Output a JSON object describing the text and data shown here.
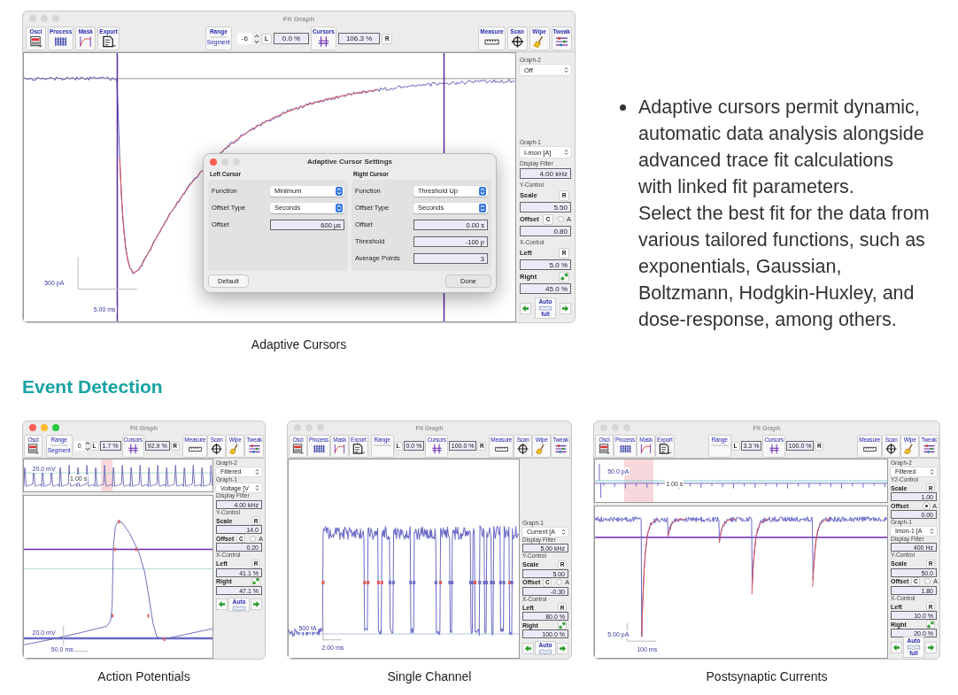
{
  "main_figure": {
    "window": {
      "title": "Fit Graph",
      "lights": [
        {
          "color": "#d6d6d6"
        },
        {
          "color": "#d6d6d6"
        },
        {
          "color": "#d6d6d6"
        }
      ],
      "tools_left": [
        {
          "label": "Osci",
          "kind": "osci"
        },
        {
          "label": "Process",
          "kind": "process"
        },
        {
          "label": "Mask",
          "kind": "mask"
        },
        {
          "label": "Export",
          "kind": "export"
        }
      ],
      "range": {
        "label": "Range",
        "sub": "Segment"
      },
      "stepper": "-6",
      "left_label": "L",
      "left_value": "0.0 %",
      "cursors": "Cursors",
      "right_value": "106.3 %",
      "right_label": "R",
      "tools_right": [
        {
          "label": "Measure",
          "kind": "measure"
        },
        {
          "label": "Scan",
          "kind": "scan"
        },
        {
          "label": "Wipe",
          "kind": "wipe"
        },
        {
          "label": "Tweak",
          "kind": "tweak"
        }
      ],
      "graph": {
        "kind": "decay",
        "y_scale": "500 pA",
        "x_scale": "5.00 ms"
      },
      "panel": [
        {
          "kind": "heading",
          "text": "Graph-2"
        },
        {
          "kind": "select",
          "value": "Off"
        },
        {
          "kind": "spacer"
        },
        {
          "kind": "heading",
          "text": "Graph-1"
        },
        {
          "kind": "select",
          "value": "I-mon [A]"
        },
        {
          "kind": "heading",
          "text": "Display Filter"
        },
        {
          "kind": "field",
          "value": "4.00 kHz"
        },
        {
          "kind": "heading",
          "text": "Y-Control"
        },
        {
          "kind": "label-button",
          "label": "Scale",
          "button": "R"
        },
        {
          "kind": "field",
          "value": "5.50"
        },
        {
          "kind": "offset",
          "label": "Offset",
          "button": "C",
          "radio_checked": false,
          "radio_label": "A"
        },
        {
          "kind": "field",
          "value": "0.80"
        },
        {
          "kind": "heading",
          "text": "X-Control"
        },
        {
          "kind": "label-button",
          "label": "Left",
          "button": "R"
        },
        {
          "kind": "field",
          "value": "5.0 %"
        },
        {
          "kind": "label-link",
          "label": "Right"
        },
        {
          "kind": "field",
          "value": "45.0 %"
        },
        {
          "kind": "nav",
          "label": "Auto",
          "sub": "full"
        }
      ]
    },
    "dialog": {
      "title": "Adaptive Cursor Settings",
      "lights": [
        {
          "color": "#fe5f57"
        },
        {
          "color": "#d6d6d6"
        },
        {
          "color": "#d6d6d6"
        }
      ],
      "groups": [
        {
          "title": "Left Cursor",
          "rows": [
            {
              "label": "Function",
              "kind": "select",
              "value": "Minimum"
            },
            {
              "label": "Offset Type",
              "kind": "select",
              "value": "Seconds"
            },
            {
              "label": "Offset",
              "kind": "field",
              "value": "600 µs"
            }
          ]
        },
        {
          "title": "Right Cursor",
          "rows": [
            {
              "label": "Function",
              "kind": "select",
              "value": "Threshold Up"
            },
            {
              "label": "Offset Type",
              "kind": "select",
              "value": "Seconds"
            },
            {
              "label": "Offset",
              "kind": "field",
              "value": "0.00 s"
            },
            {
              "label": "Threshold",
              "kind": "field",
              "value": "-100 p"
            },
            {
              "label": "Average Points",
              "kind": "field",
              "value": "3"
            }
          ]
        }
      ],
      "buttons": [
        "Default",
        "Done"
      ]
    },
    "caption": "Adaptive Cursors"
  },
  "description": {
    "paragraphs": [
      "Adaptive cursors permit dynamic, automatic data analysis alongside advanced trace fit calculations with linked fit parameters.",
      "Select the best fit for the data from various tailored functions, such as exponentials, Gaussian, Boltzmann, Hodgkin-Huxley, and dose-response, among others."
    ]
  },
  "section_heading": "Event Detection",
  "figures": [
    {
      "window": {
        "title": "Fit Graph",
        "lights": [
          {
            "color": "#fe5f57"
          },
          {
            "color": "#febc2e"
          },
          {
            "color": "#28c840"
          }
        ],
        "tools_left": [
          {
            "label": "Osci",
            "kind": "osci"
          }
        ],
        "range": {
          "label": "Range",
          "sub": "Segment"
        },
        "stepper": "0",
        "left_label": "L",
        "left_value": "1.7 %",
        "cursors": "Cursors",
        "right_value": "92.9 %",
        "right_label": "R",
        "tools_right": [
          {
            "label": "Measure",
            "kind": "measure"
          },
          {
            "label": "Scan",
            "kind": "scan"
          },
          {
            "label": "Wipe",
            "kind": "wipe"
          },
          {
            "label": "Tweak",
            "kind": "tweak"
          }
        ],
        "overview": {
          "kind": "spikes",
          "y_scale": "20.0 mV",
          "x_scale": "1.00 s"
        },
        "graph": {
          "kind": "action",
          "y_scale": "20.0 mV",
          "x_scale": "50.0 ms"
        },
        "panel": [
          {
            "kind": "heading",
            "text": "Graph-2"
          },
          {
            "kind": "select",
            "value": "Filtered"
          },
          {
            "kind": "heading",
            "text": "Graph-1"
          },
          {
            "kind": "select",
            "value": "Voltage [V"
          },
          {
            "kind": "heading",
            "text": "Display Filter"
          },
          {
            "kind": "field",
            "value": "4.00 kHz"
          },
          {
            "kind": "heading",
            "text": "Y-Control"
          },
          {
            "kind": "label-button",
            "label": "Scale",
            "button": "R"
          },
          {
            "kind": "field",
            "value": "14.0"
          },
          {
            "kind": "offset",
            "label": "Offset",
            "button": "C",
            "radio_checked": false,
            "radio_label": "A"
          },
          {
            "kind": "field",
            "value": "0.20"
          },
          {
            "kind": "heading",
            "text": "X-Control"
          },
          {
            "kind": "label-button",
            "label": "Left",
            "button": "R"
          },
          {
            "kind": "field",
            "value": "41.1 %"
          },
          {
            "kind": "label-link",
            "label": "Right"
          },
          {
            "kind": "field",
            "value": "47.1 %"
          },
          {
            "kind": "nav",
            "label": "Auto"
          }
        ]
      },
      "caption": "Action Potentials"
    },
    {
      "window": {
        "title": "Fit Graph",
        "lights": [
          {
            "color": "#d6d6d6"
          },
          {
            "color": "#d6d6d6"
          },
          {
            "color": "#d6d6d6"
          }
        ],
        "tools_left": [
          {
            "label": "Osci",
            "kind": "osci"
          },
          {
            "label": "Process",
            "kind": "process"
          },
          {
            "label": "Mask",
            "kind": "mask"
          },
          {
            "label": "Export",
            "kind": "export"
          }
        ],
        "range": {
          "label": "Range"
        },
        "left_label": "L",
        "left_value": "0.0 %",
        "cursors": "Cursors",
        "right_value": "100.0 %",
        "right_label": "R",
        "tools_right": [
          {
            "label": "Measure",
            "kind": "measure"
          },
          {
            "label": "Scan",
            "kind": "scan"
          },
          {
            "label": "Wipe",
            "kind": "wipe"
          },
          {
            "label": "Tweak",
            "kind": "tweak"
          }
        ],
        "graph": {
          "kind": "channel",
          "y_scale": "500 fA",
          "x_scale": "2.00 ms"
        },
        "panel": [
          {
            "kind": "spacer"
          },
          {
            "kind": "heading",
            "text": "Graph-1"
          },
          {
            "kind": "select",
            "value": "Current [A"
          },
          {
            "kind": "heading",
            "text": "Display Filter"
          },
          {
            "kind": "field",
            "value": "5.00 kHz"
          },
          {
            "kind": "heading",
            "text": "Y-Control"
          },
          {
            "kind": "label-button",
            "label": "Scale",
            "button": "R"
          },
          {
            "kind": "field",
            "value": "5.00"
          },
          {
            "kind": "offset",
            "label": "Offset",
            "button": "C",
            "radio_checked": false,
            "radio_label": "A"
          },
          {
            "kind": "field",
            "value": "-0.30"
          },
          {
            "kind": "heading",
            "text": "X-Control"
          },
          {
            "kind": "label-button",
            "label": "Left",
            "button": "R"
          },
          {
            "kind": "field",
            "value": "80.0 %"
          },
          {
            "kind": "label-link",
            "label": "Right"
          },
          {
            "kind": "field",
            "value": "100.0 %"
          },
          {
            "kind": "nav",
            "label": "Auto"
          }
        ]
      },
      "caption": "Single Channel"
    },
    {
      "window": {
        "title": "Fit Graph",
        "lights": [
          {
            "color": "#d6d6d6"
          },
          {
            "color": "#d6d6d6"
          },
          {
            "color": "#d6d6d6"
          }
        ],
        "tools_left": [
          {
            "label": "Osci",
            "kind": "osci"
          },
          {
            "label": "Process",
            "kind": "process"
          },
          {
            "label": "Mask",
            "kind": "mask"
          },
          {
            "label": "Export",
            "kind": "export"
          }
        ],
        "range": {
          "label": "Range"
        },
        "left_label": "L",
        "left_value": "3.3 %",
        "cursors": "Cursors",
        "right_value": "100.0 %",
        "right_label": "R",
        "tools_right": [
          {
            "label": "Measure",
            "kind": "measure"
          },
          {
            "label": "Scan",
            "kind": "scan"
          },
          {
            "label": "Wipe",
            "kind": "wipe"
          },
          {
            "label": "Tweak",
            "kind": "tweak"
          }
        ],
        "overview": {
          "kind": "flat",
          "y_scale": "50.0 pA",
          "x_scale": "1.00 s"
        },
        "graph": {
          "kind": "psc",
          "y_scale": "5.00 pA",
          "x_scale": "100 ms"
        },
        "panel": [
          {
            "kind": "heading",
            "text": "Graph-2"
          },
          {
            "kind": "select",
            "value": "Filtered"
          },
          {
            "kind": "heading",
            "text": "Y2-Control"
          },
          {
            "kind": "label-button",
            "label": "Scale",
            "button": "R"
          },
          {
            "kind": "field",
            "value": "1.00"
          },
          {
            "kind": "offset",
            "label": "Offset",
            "radio_checked": true,
            "radio_label": "A"
          },
          {
            "kind": "field",
            "value": "0.00"
          },
          {
            "kind": "heading",
            "text": "Graph-1"
          },
          {
            "kind": "select",
            "value": "Imon-1 [A"
          },
          {
            "kind": "heading",
            "text": "Display Filter"
          },
          {
            "kind": "field",
            "value": "400 Hz"
          },
          {
            "kind": "heading",
            "text": "Y-Control"
          },
          {
            "kind": "label-button",
            "label": "Scale",
            "button": "R"
          },
          {
            "kind": "field",
            "value": "50.0"
          },
          {
            "kind": "offset",
            "label": "Offset",
            "button": "C",
            "radio_checked": false,
            "radio_label": "A"
          },
          {
            "kind": "field",
            "value": "1.80"
          },
          {
            "kind": "heading",
            "text": "X-Control"
          },
          {
            "kind": "label-button",
            "label": "Left",
            "button": "R"
          },
          {
            "kind": "field",
            "value": "10.0 %"
          },
          {
            "kind": "label-link",
            "label": "Right"
          },
          {
            "kind": "field",
            "value": "20.0 %"
          },
          {
            "kind": "nav",
            "label": "Auto",
            "sub": "full"
          }
        ]
      },
      "caption": "Postsynaptic Currents"
    }
  ]
}
